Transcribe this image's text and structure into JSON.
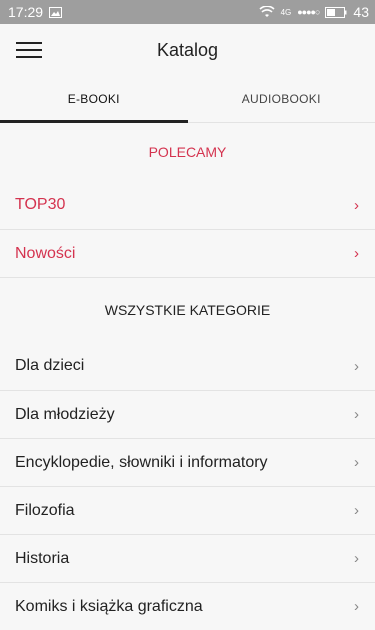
{
  "status_bar": {
    "time": "17:29",
    "network": "4G",
    "signal_dots": "●●●●○",
    "battery": "43",
    "colors": {
      "background": "#9e9e9e",
      "text": "#ffffff"
    }
  },
  "header": {
    "title": "Katalog",
    "menu_icon": "hamburger-menu-icon"
  },
  "tabs": [
    {
      "label": "E-BOOKI",
      "active": true
    },
    {
      "label": "AUDIOBOOKI",
      "active": false
    }
  ],
  "recommended": {
    "title": "POLECAMY",
    "items": [
      {
        "label": "TOP30"
      },
      {
        "label": "Nowości"
      }
    ]
  },
  "categories": {
    "title": "WSZYSTKIE KATEGORIE",
    "items": [
      {
        "label": "Dla dzieci"
      },
      {
        "label": "Dla młodzieży"
      },
      {
        "label": "Encyklopedie, słowniki i informatory"
      },
      {
        "label": "Filozofia"
      },
      {
        "label": "Historia"
      },
      {
        "label": "Komiks i książka graficzna"
      }
    ]
  },
  "colors": {
    "accent": "#d4334f",
    "background": "#f7f7f7",
    "divider": "#e3e3e3"
  }
}
